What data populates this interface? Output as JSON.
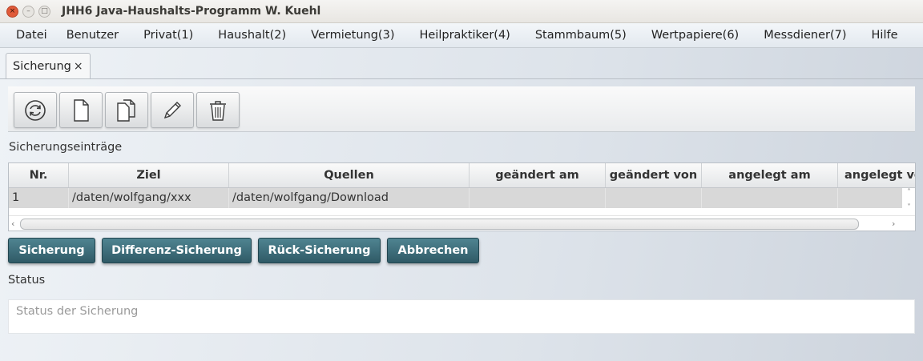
{
  "window": {
    "title": "JHH6 Java-Haushalts-Programm W. Kuehl",
    "close_glyph": "×",
    "min_glyph": "–",
    "max_glyph": "□"
  },
  "menubar": {
    "items": [
      {
        "label": "Datei"
      },
      {
        "label": "Benutzer"
      },
      {
        "label": "Privat(1)"
      },
      {
        "label": "Haushalt(2)"
      },
      {
        "label": "Vermietung(3)"
      },
      {
        "label": "Heilpraktiker(4)"
      },
      {
        "label": "Stammbaum(5)"
      },
      {
        "label": "Wertpapiere(6)"
      },
      {
        "label": "Messdiener(7)"
      },
      {
        "label": "Hilfe"
      }
    ]
  },
  "tab": {
    "label": "Sicherung",
    "close_glyph": "×"
  },
  "toolbar": {
    "buttons": [
      {
        "icon": "refresh-icon"
      },
      {
        "icon": "new-document-icon"
      },
      {
        "icon": "copy-document-icon"
      },
      {
        "icon": "edit-pencil-icon"
      },
      {
        "icon": "trash-icon"
      }
    ]
  },
  "entries": {
    "section_label": "Sicherungseinträge",
    "columns": [
      "Nr.",
      "Ziel",
      "Quellen",
      "geändert am",
      "geändert von",
      "angelegt am",
      "angelegt von"
    ],
    "rows": [
      {
        "nr": "1",
        "ziel": "/daten/wolfgang/xxx",
        "quellen": "/daten/wolfgang/Download",
        "geaendert_am": "",
        "geaendert_von": "",
        "angelegt_am": "",
        "angelegt_von": ""
      }
    ],
    "scroll": {
      "up": "˄",
      "down": "˅",
      "left": "‹",
      "right": "›"
    }
  },
  "actions": {
    "backup": "Sicherung",
    "diff_backup": "Differenz-Sicherung",
    "restore": "Rück-Sicherung",
    "cancel": "Abbrechen"
  },
  "status": {
    "label": "Status",
    "placeholder": "Status der Sicherung"
  },
  "colors": {
    "action_button": "#3e6f7b",
    "close_button": "#e05a39"
  }
}
